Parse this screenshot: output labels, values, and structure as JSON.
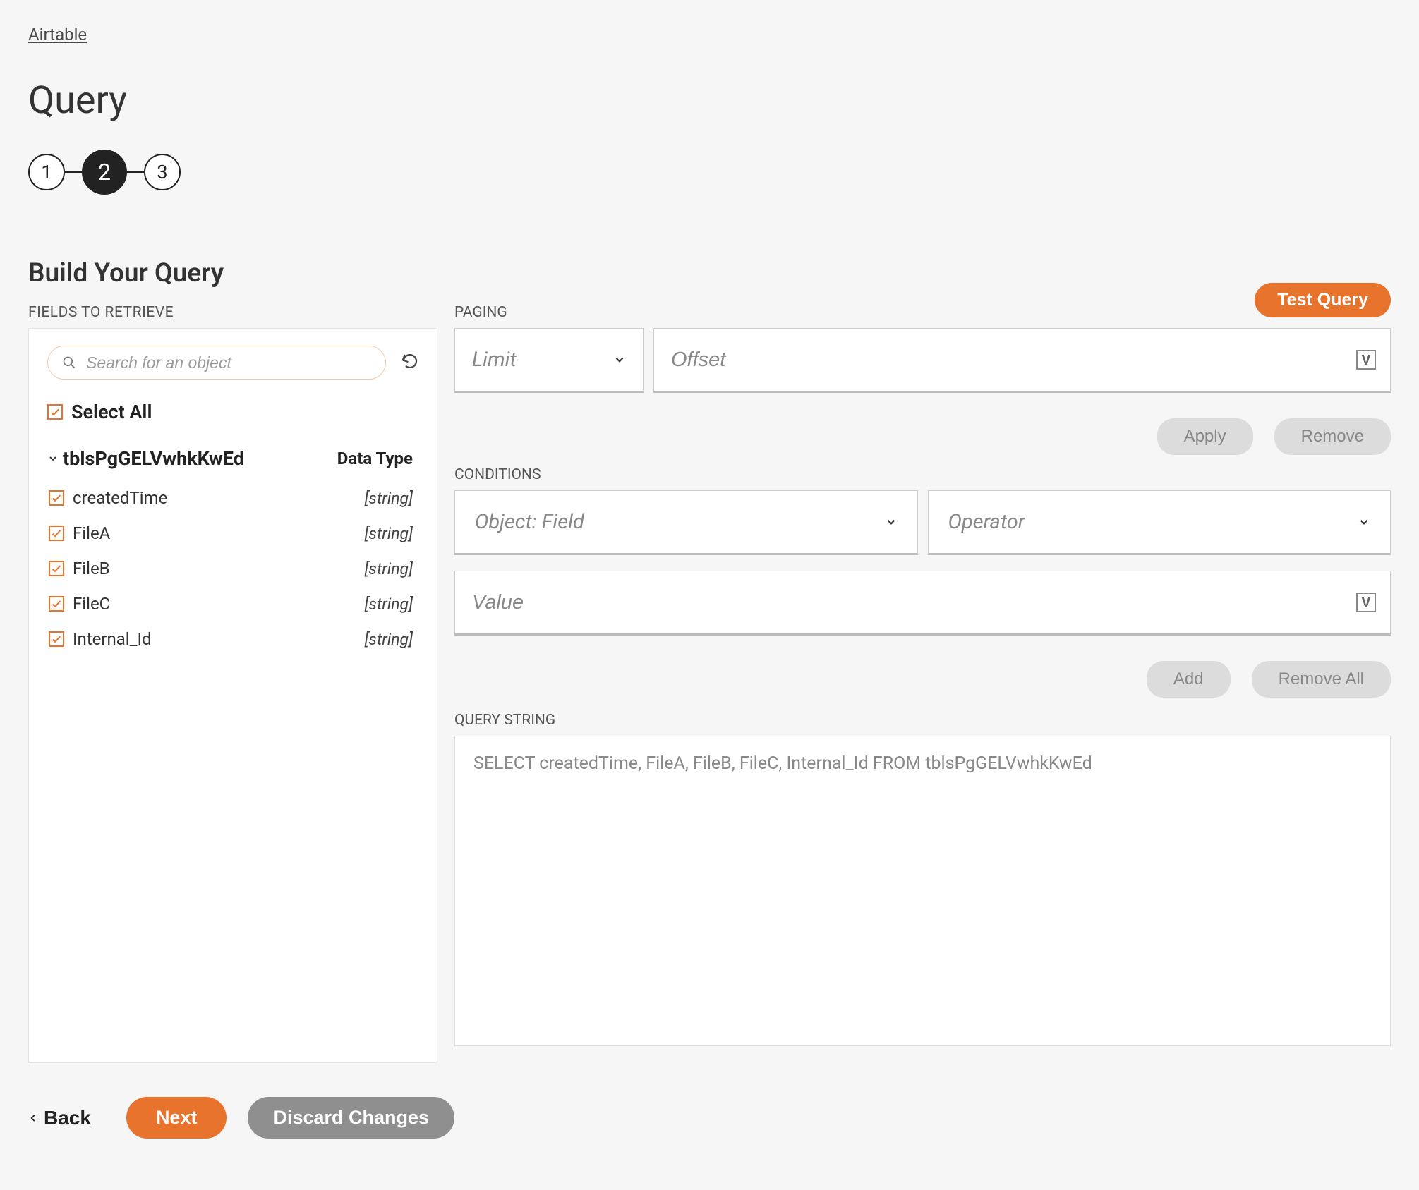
{
  "breadcrumb": "Airtable",
  "title": "Query",
  "stepper": {
    "steps": [
      "1",
      "2",
      "3"
    ],
    "active": 1
  },
  "section_title": "Build Your Query",
  "fields": {
    "label": "FIELDS TO RETRIEVE",
    "search_placeholder": "Search for an object",
    "select_all_label": "Select All",
    "table_name": "tblsPgGELVwhkKwEd",
    "data_type_header": "Data Type",
    "rows": [
      {
        "name": "createdTime",
        "type": "[string]",
        "checked": true
      },
      {
        "name": "FileA",
        "type": "[string]",
        "checked": true
      },
      {
        "name": "FileB",
        "type": "[string]",
        "checked": true
      },
      {
        "name": "FileC",
        "type": "[string]",
        "checked": true
      },
      {
        "name": "Internal_Id",
        "type": "[string]",
        "checked": true
      }
    ]
  },
  "paging": {
    "label": "PAGING",
    "limit_placeholder": "Limit",
    "offset_placeholder": "Offset"
  },
  "buttons": {
    "test_query": "Test Query",
    "apply": "Apply",
    "remove": "Remove",
    "add": "Add",
    "remove_all": "Remove All",
    "back": "Back",
    "next": "Next",
    "discard": "Discard Changes"
  },
  "conditions": {
    "label": "CONDITIONS",
    "field_placeholder": "Object: Field",
    "operator_placeholder": "Operator",
    "value_placeholder": "Value"
  },
  "query_string": {
    "label": "QUERY STRING",
    "value": "SELECT createdTime, FileA, FileB, FileC, Internal_Id FROM tblsPgGELVwhkKwEd"
  }
}
